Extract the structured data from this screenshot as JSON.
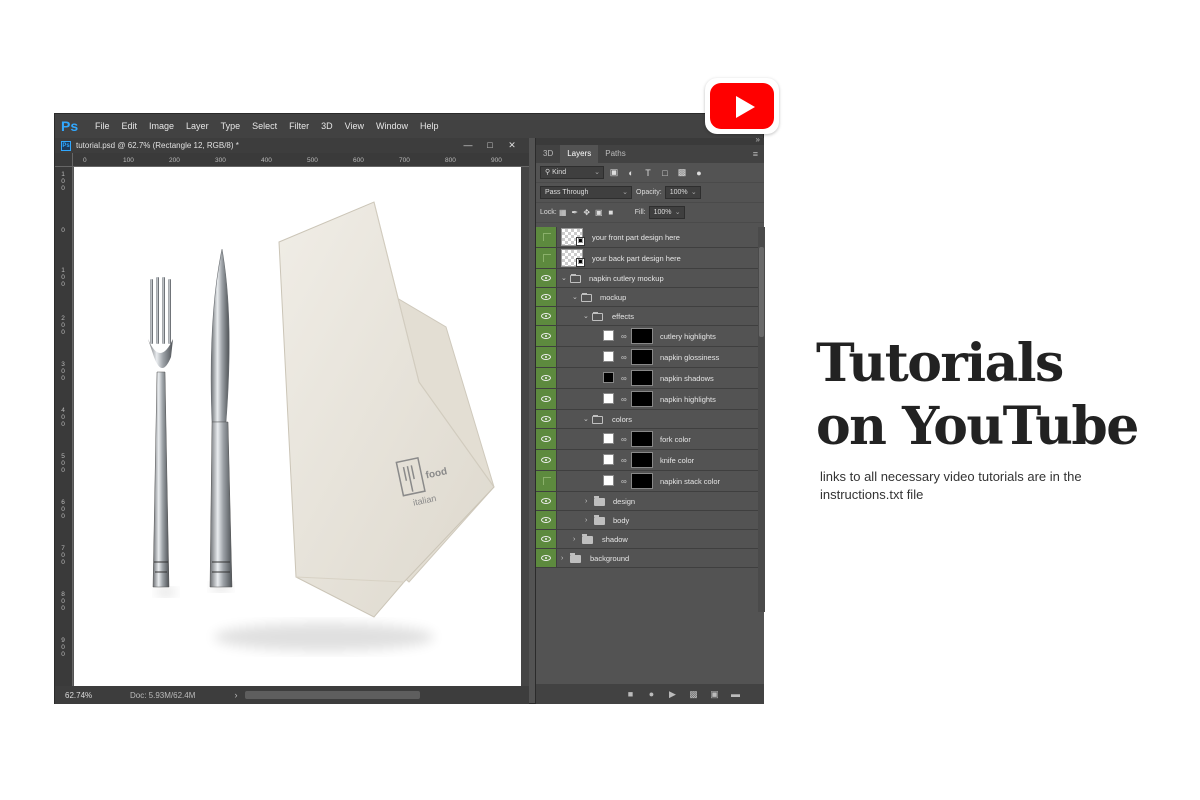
{
  "app": {
    "logo": "Ps",
    "menu": [
      "File",
      "Edit",
      "Image",
      "Layer",
      "Type",
      "Select",
      "Filter",
      "3D",
      "View",
      "Window",
      "Help"
    ],
    "minimize_icon": "minimize-icon"
  },
  "document": {
    "tab_title": "tutorial.psd @ 62.7% (Rectangle 12, RGB/8) *",
    "ruler_h_ticks": [
      "0",
      "100",
      "200",
      "300",
      "400",
      "500",
      "600",
      "700",
      "800",
      "900"
    ],
    "ruler_v_ticks": [
      "1 0 0",
      "0",
      "1 0 0",
      "2 0 0",
      "3 0 0",
      "4 0 0",
      "5 0 0",
      "6 0 0",
      "7 0 0",
      "8 0 0",
      "9 0 0"
    ],
    "zoom": "62.74%",
    "doc_size": "Doc: 5.93M/62.4M",
    "logo_text_line1": "italian",
    "logo_text_line2": "food"
  },
  "panel": {
    "tabs": [
      "3D",
      "Layers",
      "Paths"
    ],
    "active_tab": "Layers",
    "filter_kind": "Kind",
    "blend_mode": "Pass Through",
    "opacity_label": "Opacity:",
    "opacity_value": "100%",
    "lock_label": "Lock:",
    "fill_label": "Fill:",
    "fill_value": "100%",
    "layers": [
      {
        "name": "your front part design here",
        "kind": "smart",
        "visible": false
      },
      {
        "name": "your back part design here",
        "kind": "smart",
        "visible": false
      },
      {
        "name": "napkin cutlery mockup",
        "kind": "group-open",
        "visible": true
      },
      {
        "name": "mockup",
        "kind": "group-open",
        "visible": true
      },
      {
        "name": "effects",
        "kind": "group-open",
        "visible": true
      },
      {
        "name": "cutlery highlights",
        "kind": "fill",
        "swatch": "#ffffff",
        "visible": true
      },
      {
        "name": "napkin glossiness",
        "kind": "fill",
        "swatch": "#ffffff",
        "visible": true
      },
      {
        "name": "napkin shadows",
        "kind": "fill",
        "swatch": "#000000",
        "visible": true
      },
      {
        "name": "napkin highlights",
        "kind": "fill",
        "swatch": "#ffffff",
        "visible": true
      },
      {
        "name": "colors",
        "kind": "group-open",
        "visible": true
      },
      {
        "name": "fork color",
        "kind": "fill",
        "swatch": "#ffffff",
        "visible": true
      },
      {
        "name": "knife color",
        "kind": "fill",
        "swatch": "#ffffff",
        "visible": true
      },
      {
        "name": "napkin stack color",
        "kind": "fill",
        "swatch": "#ffffff",
        "visible": false
      },
      {
        "name": "design",
        "kind": "group-closed",
        "visible": true
      },
      {
        "name": "body",
        "kind": "group-closed",
        "visible": true
      },
      {
        "name": "shadow",
        "kind": "group-closed",
        "visible": true
      },
      {
        "name": "background",
        "kind": "group-closed",
        "visible": true
      }
    ]
  },
  "promo": {
    "headline_line1": "Tutorials",
    "headline_line2": "on YouTube",
    "subline": "links to all necessary video tutorials are in the instructions.txt file"
  },
  "colors": {
    "youtube_red": "#ff0000",
    "layer_eye_green": "#5d8a3e",
    "ps_blue": "#31a8ff"
  }
}
